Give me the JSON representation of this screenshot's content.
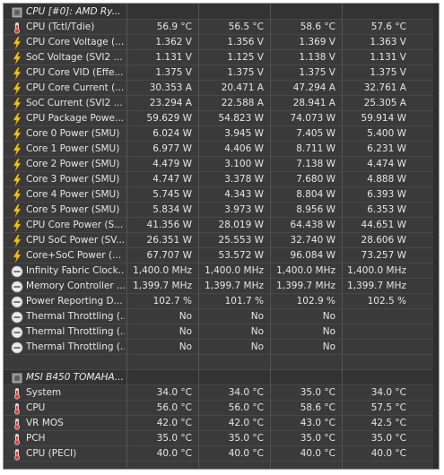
{
  "section1": {
    "title": "CPU [#0]: AMD Ry...",
    "rows": [
      {
        "icon": "thermometer",
        "label": "CPU (Tctl/Tdie)",
        "values": [
          "56.9 °C",
          "56.5 °C",
          "58.6 °C",
          "57.6 °C"
        ]
      },
      {
        "icon": "bolt",
        "label": "CPU Core Voltage (...",
        "values": [
          "1.362 V",
          "1.356 V",
          "1.369 V",
          "1.363 V"
        ]
      },
      {
        "icon": "bolt",
        "label": "SoC Voltage (SVI2 ...",
        "values": [
          "1.131 V",
          "1.125 V",
          "1.138 V",
          "1.131 V"
        ]
      },
      {
        "icon": "bolt",
        "label": "CPU Core VID (Effe...",
        "values": [
          "1.375 V",
          "1.375 V",
          "1.375 V",
          "1.375 V"
        ]
      },
      {
        "icon": "bolt",
        "label": "CPU Core Current (...",
        "values": [
          "30.353 A",
          "20.471 A",
          "47.294 A",
          "32.761 A"
        ]
      },
      {
        "icon": "bolt",
        "label": "SoC Current (SVI2 ...",
        "values": [
          "23.294 A",
          "22.588 A",
          "28.941 A",
          "25.305 A"
        ]
      },
      {
        "icon": "bolt",
        "label": "CPU Package Powe...",
        "values": [
          "59.629 W",
          "54.823 W",
          "74.073 W",
          "59.914 W"
        ]
      },
      {
        "icon": "bolt",
        "label": "Core 0 Power (SMU)",
        "values": [
          "6.024 W",
          "3.945 W",
          "7.405 W",
          "5.400 W"
        ]
      },
      {
        "icon": "bolt",
        "label": "Core 1 Power (SMU)",
        "values": [
          "6.977 W",
          "4.406 W",
          "8.711 W",
          "6.231 W"
        ]
      },
      {
        "icon": "bolt",
        "label": "Core 2 Power (SMU)",
        "values": [
          "4.479 W",
          "3.100 W",
          "7.138 W",
          "4.474 W"
        ]
      },
      {
        "icon": "bolt",
        "label": "Core 3 Power (SMU)",
        "values": [
          "4.747 W",
          "3.378 W",
          "7.680 W",
          "4.888 W"
        ]
      },
      {
        "icon": "bolt",
        "label": "Core 4 Power (SMU)",
        "values": [
          "5.745 W",
          "4.343 W",
          "8.804 W",
          "6.393 W"
        ]
      },
      {
        "icon": "bolt",
        "label": "Core 5 Power (SMU)",
        "values": [
          "5.834 W",
          "3.973 W",
          "8.956 W",
          "6.353 W"
        ]
      },
      {
        "icon": "bolt",
        "label": "CPU Core Power (S...",
        "values": [
          "41.356 W",
          "28.019 W",
          "64.438 W",
          "44.651 W"
        ]
      },
      {
        "icon": "bolt",
        "label": "CPU SoC Power (SV...",
        "values": [
          "26.351 W",
          "25.553 W",
          "32.740 W",
          "28.606 W"
        ]
      },
      {
        "icon": "bolt",
        "label": "Core+SoC Power (...",
        "values": [
          "67.707 W",
          "53.572 W",
          "96.084 W",
          "73.257 W"
        ]
      },
      {
        "icon": "circle",
        "label": "Infinity Fabric Clock...",
        "values": [
          "1,400.0 MHz",
          "1,400.0 MHz",
          "1,400.0 MHz",
          "1,400.0 MHz"
        ]
      },
      {
        "icon": "circle",
        "label": "Memory Controller ...",
        "values": [
          "1,399.7 MHz",
          "1,399.7 MHz",
          "1,399.7 MHz",
          "1,399.7 MHz"
        ]
      },
      {
        "icon": "circle",
        "label": "Power Reporting D...",
        "values": [
          "102.7 %",
          "101.7 %",
          "102.9 %",
          "102.5 %"
        ]
      },
      {
        "icon": "circle",
        "label": "Thermal Throttling (...",
        "values": [
          "No",
          "No",
          "No",
          ""
        ]
      },
      {
        "icon": "circle",
        "label": "Thermal Throttling (...",
        "values": [
          "No",
          "No",
          "No",
          ""
        ]
      },
      {
        "icon": "circle",
        "label": "Thermal Throttling (...",
        "values": [
          "No",
          "No",
          "No",
          ""
        ]
      }
    ]
  },
  "section2": {
    "title": "MSI B450 TOMAHA...",
    "rows": [
      {
        "icon": "thermometer",
        "label": "System",
        "values": [
          "34.0 °C",
          "34.0 °C",
          "35.0 °C",
          "34.0 °C"
        ]
      },
      {
        "icon": "thermometer",
        "label": "CPU",
        "values": [
          "56.0 °C",
          "56.0 °C",
          "58.6 °C",
          "57.5 °C"
        ]
      },
      {
        "icon": "thermometer",
        "label": "VR MOS",
        "values": [
          "42.0 °C",
          "42.0 °C",
          "43.0 °C",
          "42.5 °C"
        ]
      },
      {
        "icon": "thermometer",
        "label": "PCH",
        "values": [
          "35.0 °C",
          "35.0 °C",
          "35.0 °C",
          "35.0 °C"
        ]
      },
      {
        "icon": "thermometer",
        "label": "CPU (PECI)",
        "values": [
          "40.0 °C",
          "40.0 °C",
          "40.0 °C",
          "40.0 °C"
        ]
      }
    ]
  },
  "colors": {
    "background": "#3a3a3a",
    "text": "#e6e6e6",
    "grid": "#555555"
  }
}
